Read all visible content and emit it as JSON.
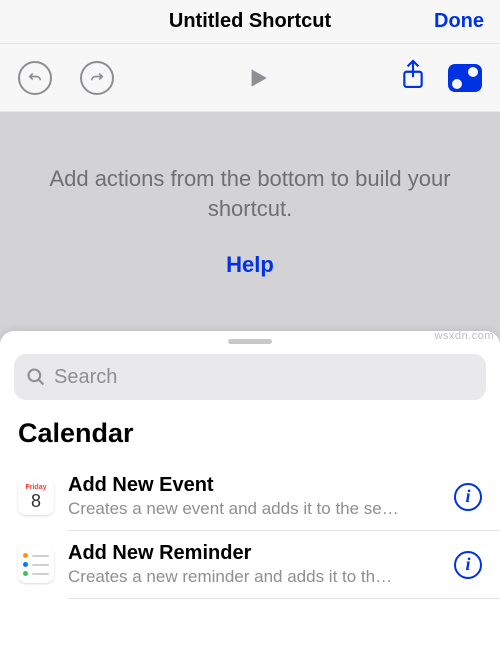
{
  "header": {
    "title": "Untitled Shortcut",
    "done_label": "Done"
  },
  "toolbar": {
    "undo": "undo-icon",
    "redo": "redo-icon",
    "play": "play-icon",
    "share": "share-icon",
    "settings": "settings-icon"
  },
  "build_area": {
    "message": "Add actions from the bottom to build your shortcut.",
    "help_label": "Help"
  },
  "panel": {
    "search_placeholder": "Search",
    "section_title": "Calendar",
    "actions": [
      {
        "icon_day_label": "Friday",
        "icon_day_num": "8",
        "title": "Add New Event",
        "desc": "Creates a new event and adds it to the se…"
      },
      {
        "title": "Add New Reminder",
        "desc": "Creates a new reminder and adds it to th…"
      }
    ]
  },
  "watermark": "wsxdn.com"
}
